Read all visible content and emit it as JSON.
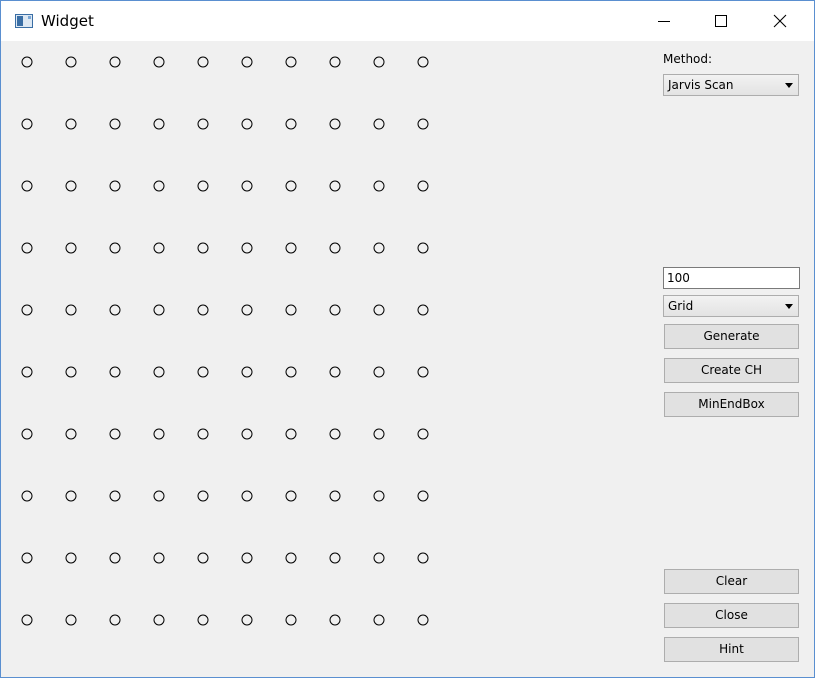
{
  "window": {
    "title": "Widget",
    "icon": "app-window-icon",
    "border_color": "#5a8fd0",
    "background": "#f0f0f0"
  },
  "controls": {
    "method_label": "Method:",
    "method_value": "Jarvis Scan",
    "point_count_value": "100",
    "distribution_value": "Grid",
    "generate_label": "Generate",
    "create_ch_label": "Create CH",
    "min_end_box_label": "MinEndBox",
    "clear_label": "Clear",
    "close_label": "Close",
    "hint_label": "Hint"
  },
  "canvas": {
    "point_style": "circle-outline",
    "point_color": "#000000",
    "grid_columns": 10,
    "grid_rows": 10,
    "point_count": 100
  }
}
